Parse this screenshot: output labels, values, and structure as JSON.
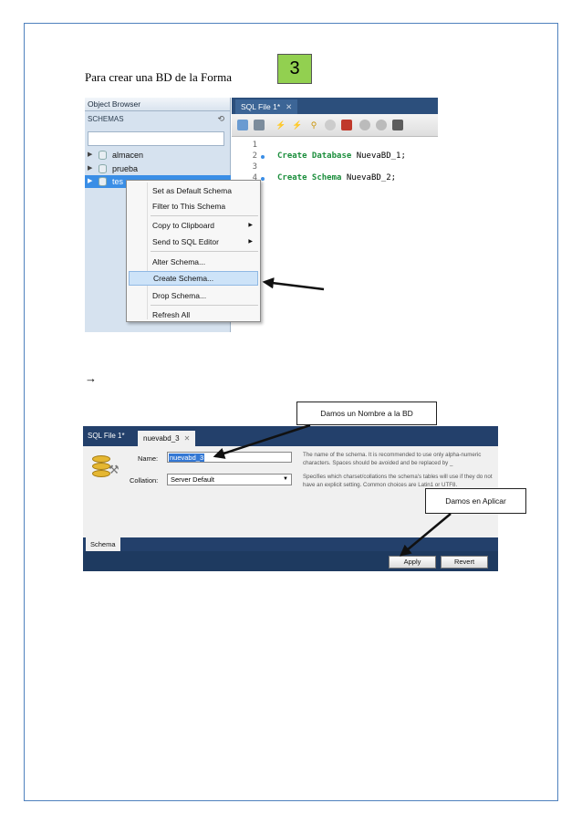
{
  "heading": "Para crear una BD de  la Forma",
  "step_number": "3",
  "object_browser": {
    "title": "Object Browser",
    "schemas_label": "SCHEMAS",
    "refresh_icon": "refresh-icon",
    "tree": [
      {
        "label": "almacen",
        "selected": false
      },
      {
        "label": "prueba",
        "selected": false
      },
      {
        "label": "tes",
        "selected": true
      }
    ]
  },
  "sql_editor": {
    "tab_label": "SQL File 1*",
    "tab_close": "✕",
    "lines": [
      {
        "num": "1",
        "keyword": "",
        "rest": ""
      },
      {
        "num": "2",
        "keyword": "Create Database",
        "rest": " NuevaBD_1;"
      },
      {
        "num": "3",
        "keyword": "",
        "rest": ""
      },
      {
        "num": "4",
        "keyword": "Create Schema",
        "rest": " NuevaBD_2;"
      }
    ]
  },
  "context_menu": {
    "items": [
      {
        "label": "Set as Default Schema"
      },
      {
        "label": "Filter to This Schema"
      },
      {
        "label": "Copy to Clipboard",
        "submenu": "▶"
      },
      {
        "label": "Send to SQL Editor",
        "submenu": "▶"
      },
      {
        "label": "Alter Schema..."
      },
      {
        "label": "Create Schema..."
      },
      {
        "label": "Drop Schema..."
      },
      {
        "label": "Refresh All"
      }
    ]
  },
  "arrow_symbol": "→",
  "schema_editor": {
    "tab1": "SQL File 1*",
    "tab2": "nuevabd_3",
    "tab2_close": "✕",
    "name_label": "Name:",
    "name_value": "nuevabd_3",
    "collation_label": "Collation:",
    "collation_value": "Server Default",
    "collation_arrow": "▼",
    "name_hint": "The name of the schema. It is recommended to use only alpha-numeric characters. Spaces should be avoided and be replaced by _",
    "collation_hint": "Specifies which charset/collations the schema's tables will use if they do not have an explicit setting. Common choices are Latin1 or UTF8.",
    "bottom_tab": "Schema",
    "apply_label": "Apply",
    "revert_label": "Revert"
  },
  "callouts": {
    "name_bd": "Damos un Nombre a la BD",
    "apply": "Damos en Aplicar"
  },
  "colors": {
    "page_border": "#4f81bd",
    "step_box": "#92d050",
    "selection": "#3a8ee6",
    "keyword": "#1b8e3c"
  }
}
